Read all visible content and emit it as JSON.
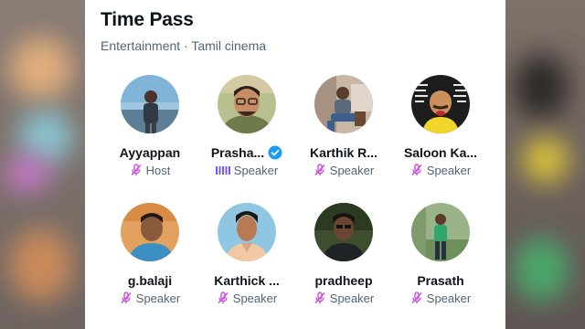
{
  "space": {
    "title": "Time Pass",
    "subtitle": "Entertainment · Tamil cinema"
  },
  "participants": [
    {
      "name": "Ayyappan",
      "role": "Host",
      "verified": false,
      "speaking": false
    },
    {
      "name": "Prasha...",
      "role": "Speaker",
      "verified": true,
      "speaking": true
    },
    {
      "name": "Karthik R...",
      "role": "Speaker",
      "verified": false,
      "speaking": false
    },
    {
      "name": "Saloon Ka...",
      "role": "Speaker",
      "verified": false,
      "speaking": false
    },
    {
      "name": "g.balaji",
      "role": "Speaker",
      "verified": false,
      "speaking": false
    },
    {
      "name": "Karthick ...",
      "role": "Speaker",
      "verified": false,
      "speaking": false
    },
    {
      "name": "pradheep",
      "role": "Speaker",
      "verified": false,
      "speaking": false
    },
    {
      "name": "Prasath",
      "role": "Speaker",
      "verified": false,
      "speaking": false
    }
  ],
  "colors": {
    "mic_muted": "#c94fd9",
    "speaking_wave": "#7856ff",
    "verified": "#1d9bf0"
  }
}
